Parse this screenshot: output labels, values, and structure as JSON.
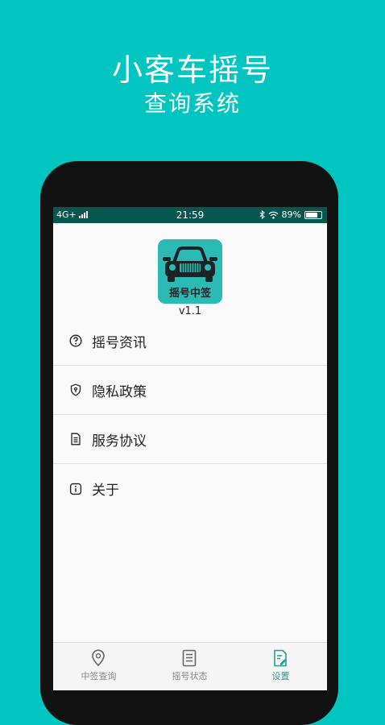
{
  "promo": {
    "title": "小客车摇号",
    "subtitle": "查询系统"
  },
  "status_bar": {
    "network": "4G+",
    "time": "21:59",
    "battery_percent": "89%",
    "battery_level": 0.89,
    "icons": [
      "signal-icon",
      "bluetooth-icon",
      "wifi-icon",
      "battery-icon"
    ]
  },
  "app": {
    "logo_text": "摇号中签",
    "version": "v1.1",
    "logo_color": "#2cbbb4"
  },
  "menu": [
    {
      "label": "摇号资讯",
      "icon": "question-circle-icon"
    },
    {
      "label": "隐私政策",
      "icon": "shield-icon"
    },
    {
      "label": "服务协议",
      "icon": "document-icon"
    },
    {
      "label": "关于",
      "icon": "info-icon"
    }
  ],
  "tabs": [
    {
      "label": "中签查询",
      "icon": "location-pin-icon",
      "active": false
    },
    {
      "label": "摇号状态",
      "icon": "receipt-icon",
      "active": false
    },
    {
      "label": "设置",
      "icon": "settings-document-icon",
      "active": true
    }
  ],
  "colors": {
    "background": "#00c5c1",
    "status_bar": "#07574f",
    "active_tab": "#2a9c94",
    "inactive_tab": "#888888"
  }
}
